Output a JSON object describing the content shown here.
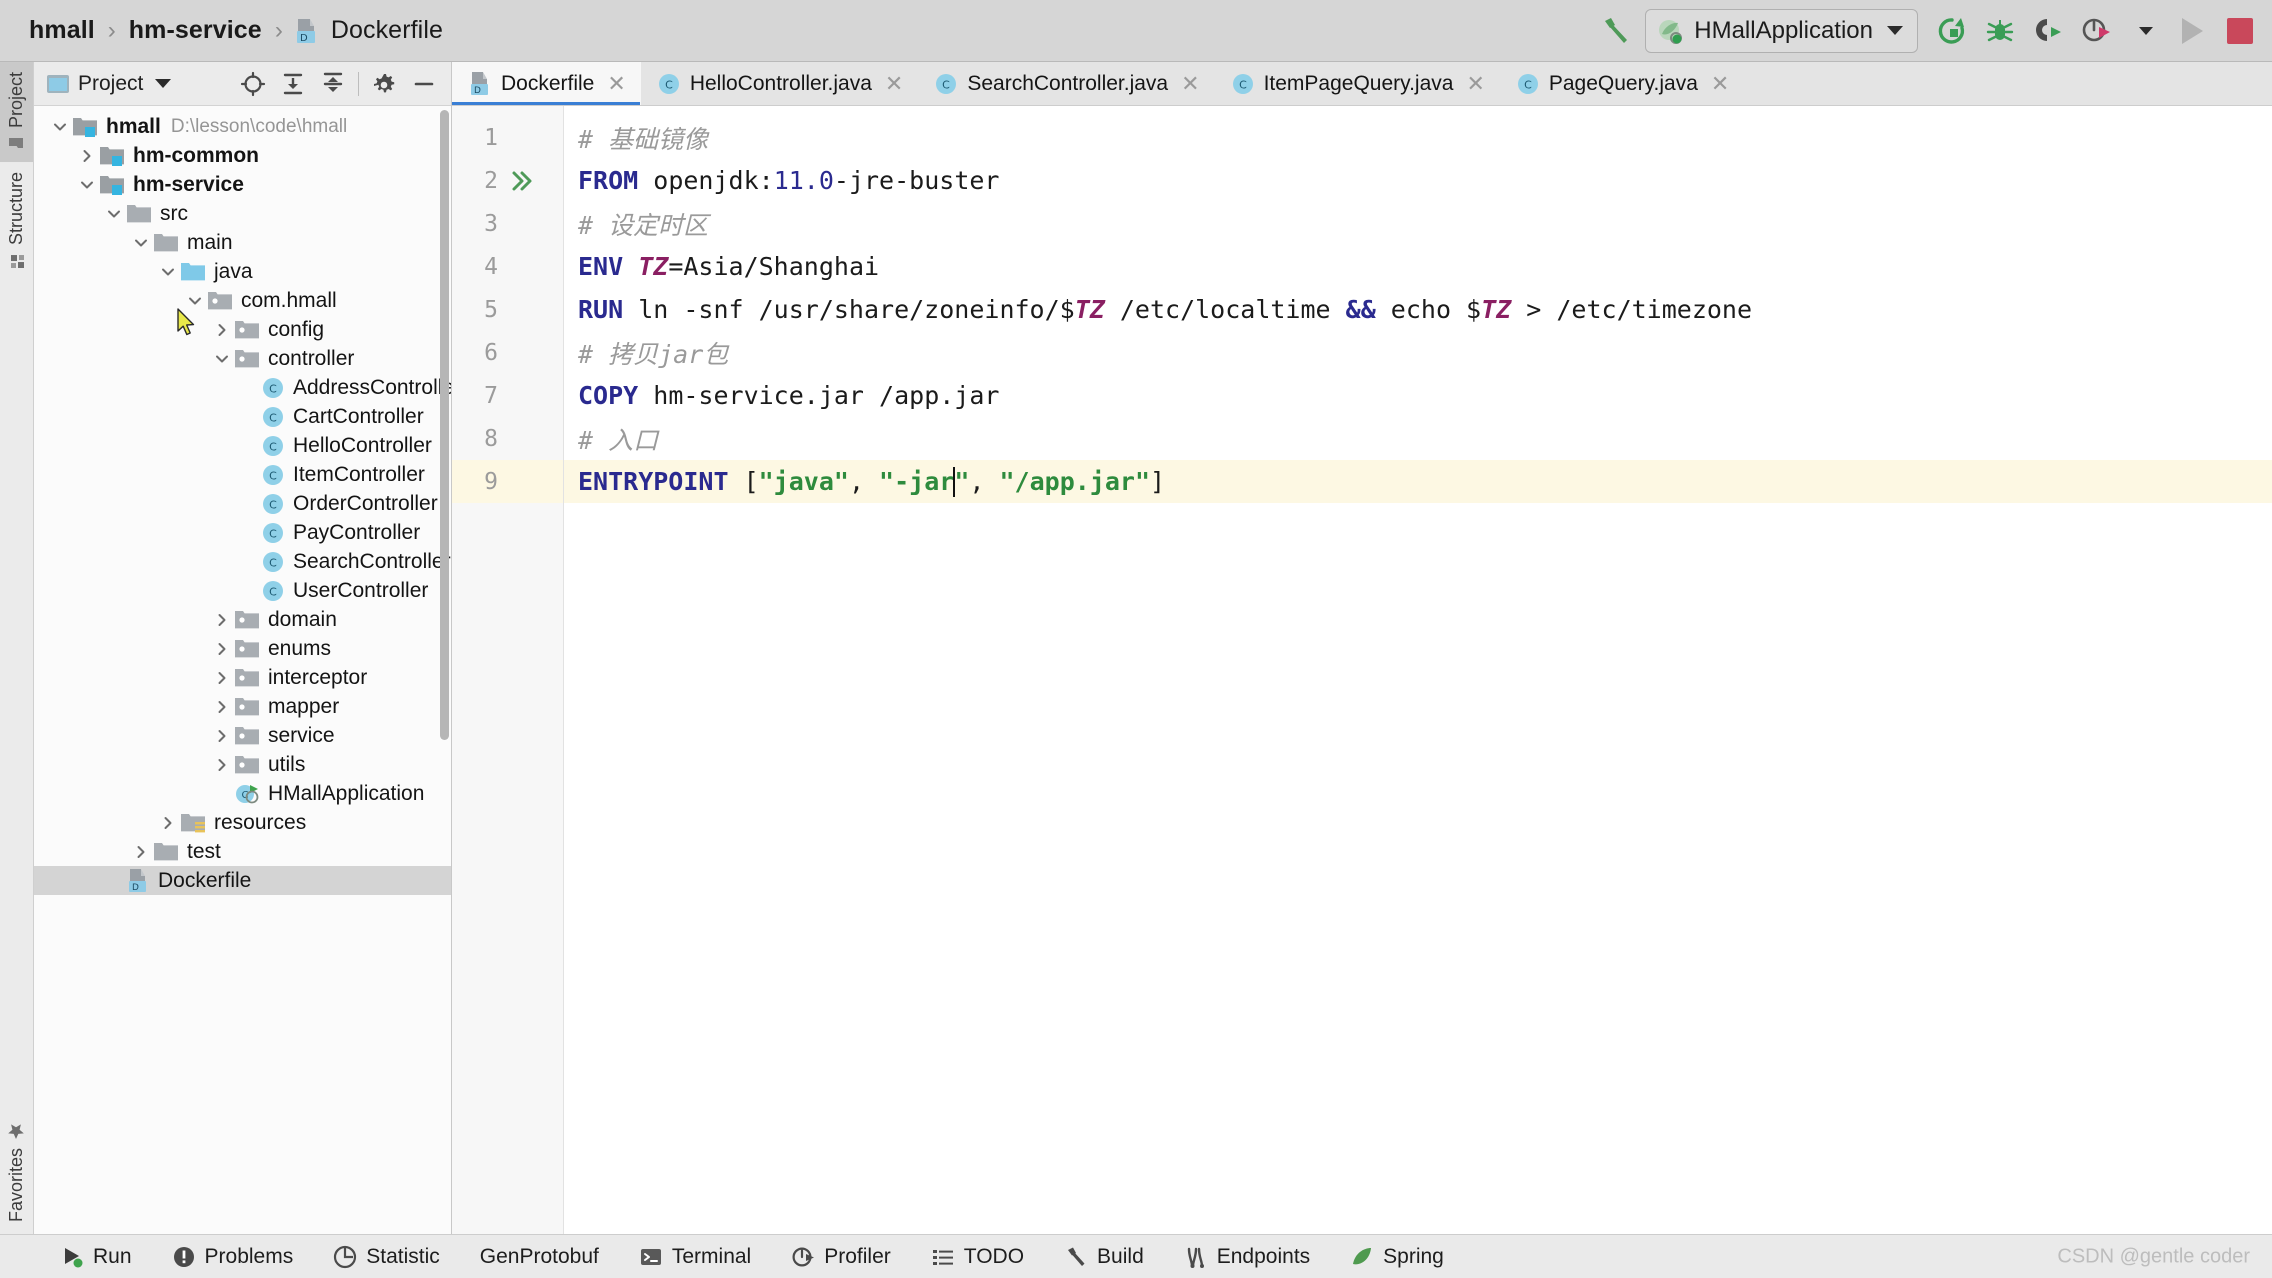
{
  "window": {
    "app": "IntelliJ IDEA",
    "watermark": "CSDN @gentle coder"
  },
  "breadcrumb": {
    "project": "hmall",
    "module": "hm-service",
    "file": "Dockerfile",
    "separator": "›"
  },
  "toolbar": {
    "build_icon": "hammer-icon",
    "run_config": {
      "label": "HMallApplication",
      "icon": "spring-boot-icon"
    },
    "buttons": [
      {
        "name": "rerun-icon",
        "title": "Rerun"
      },
      {
        "name": "debug-icon",
        "title": "Debug"
      },
      {
        "name": "run-with-coverage-icon",
        "title": "Run with Coverage"
      },
      {
        "name": "profiler-run-icon",
        "title": "Profile"
      },
      {
        "name": "chevron-down-icon",
        "title": "More"
      },
      {
        "name": "run-icon",
        "title": "Run"
      },
      {
        "name": "stop-icon",
        "title": "Stop"
      }
    ]
  },
  "rail": {
    "top": [
      {
        "label": "Project",
        "icon": "folder-icon",
        "active": true
      },
      {
        "label": "Structure",
        "icon": "structure-icon",
        "active": false
      }
    ],
    "bottom": [
      {
        "label": "Favorites",
        "icon": "star-icon",
        "active": false
      }
    ]
  },
  "project_panel": {
    "title": "Project",
    "title_caret": "▾",
    "actions": [
      {
        "name": "locate-file-icon"
      },
      {
        "name": "expand-all-icon"
      },
      {
        "name": "collapse-all-icon"
      },
      {
        "name": "settings-gear-icon"
      },
      {
        "name": "hide-panel-icon"
      }
    ],
    "tree": [
      {
        "indent": 0,
        "twisty": "down",
        "icon": "module-folder-icon",
        "label": "hmall",
        "bold": true,
        "path": "D:\\lesson\\code\\hmall",
        "selected": false
      },
      {
        "indent": 1,
        "twisty": "right",
        "icon": "module-folder-icon",
        "label": "hm-common",
        "bold": true,
        "path": "",
        "selected": false
      },
      {
        "indent": 1,
        "twisty": "down",
        "icon": "module-folder-icon",
        "label": "hm-service",
        "bold": true,
        "path": "",
        "selected": false
      },
      {
        "indent": 2,
        "twisty": "down",
        "icon": "folder-icon",
        "label": "src",
        "bold": false,
        "path": "",
        "selected": false
      },
      {
        "indent": 3,
        "twisty": "down",
        "icon": "folder-icon",
        "label": "main",
        "bold": false,
        "path": "",
        "selected": false
      },
      {
        "indent": 4,
        "twisty": "down",
        "icon": "source-folder-icon",
        "label": "java",
        "bold": false,
        "path": "",
        "selected": false
      },
      {
        "indent": 5,
        "twisty": "down",
        "icon": "package-icon",
        "label": "com.hmall",
        "bold": false,
        "path": "",
        "selected": false
      },
      {
        "indent": 6,
        "twisty": "right",
        "icon": "package-icon",
        "label": "config",
        "bold": false,
        "path": "",
        "selected": false
      },
      {
        "indent": 6,
        "twisty": "down",
        "icon": "package-icon",
        "label": "controller",
        "bold": false,
        "path": "",
        "selected": false
      },
      {
        "indent": 7,
        "twisty": "none",
        "icon": "java-class-icon",
        "label": "AddressController",
        "bold": false,
        "path": "",
        "selected": false
      },
      {
        "indent": 7,
        "twisty": "none",
        "icon": "java-class-icon",
        "label": "CartController",
        "bold": false,
        "path": "",
        "selected": false
      },
      {
        "indent": 7,
        "twisty": "none",
        "icon": "java-class-icon",
        "label": "HelloController",
        "bold": false,
        "path": "",
        "selected": false
      },
      {
        "indent": 7,
        "twisty": "none",
        "icon": "java-class-icon",
        "label": "ItemController",
        "bold": false,
        "path": "",
        "selected": false
      },
      {
        "indent": 7,
        "twisty": "none",
        "icon": "java-class-icon",
        "label": "OrderController",
        "bold": false,
        "path": "",
        "selected": false
      },
      {
        "indent": 7,
        "twisty": "none",
        "icon": "java-class-icon",
        "label": "PayController",
        "bold": false,
        "path": "",
        "selected": false
      },
      {
        "indent": 7,
        "twisty": "none",
        "icon": "java-class-icon",
        "label": "SearchController",
        "bold": false,
        "path": "",
        "selected": false
      },
      {
        "indent": 7,
        "twisty": "none",
        "icon": "java-class-icon",
        "label": "UserController",
        "bold": false,
        "path": "",
        "selected": false
      },
      {
        "indent": 6,
        "twisty": "right",
        "icon": "package-icon",
        "label": "domain",
        "bold": false,
        "path": "",
        "selected": false
      },
      {
        "indent": 6,
        "twisty": "right",
        "icon": "package-icon",
        "label": "enums",
        "bold": false,
        "path": "",
        "selected": false
      },
      {
        "indent": 6,
        "twisty": "right",
        "icon": "package-icon",
        "label": "interceptor",
        "bold": false,
        "path": "",
        "selected": false
      },
      {
        "indent": 6,
        "twisty": "right",
        "icon": "package-icon",
        "label": "mapper",
        "bold": false,
        "path": "",
        "selected": false
      },
      {
        "indent": 6,
        "twisty": "right",
        "icon": "package-icon",
        "label": "service",
        "bold": false,
        "path": "",
        "selected": false
      },
      {
        "indent": 6,
        "twisty": "right",
        "icon": "package-icon",
        "label": "utils",
        "bold": false,
        "path": "",
        "selected": false
      },
      {
        "indent": 6,
        "twisty": "none",
        "icon": "spring-boot-class-icon",
        "label": "HMallApplication",
        "bold": false,
        "path": "",
        "selected": false
      },
      {
        "indent": 4,
        "twisty": "right",
        "icon": "resources-folder-icon",
        "label": "resources",
        "bold": false,
        "path": "",
        "selected": false
      },
      {
        "indent": 3,
        "twisty": "right",
        "icon": "folder-icon",
        "label": "test",
        "bold": false,
        "path": "",
        "selected": false
      },
      {
        "indent": 2,
        "twisty": "none",
        "icon": "dockerfile-icon",
        "label": "Dockerfile",
        "bold": false,
        "path": "",
        "selected": true
      }
    ]
  },
  "editor": {
    "tabs": [
      {
        "label": "Dockerfile",
        "icon": "dockerfile-icon",
        "active": true,
        "close": "✕"
      },
      {
        "label": "HelloController.java",
        "icon": "java-class-icon",
        "active": false,
        "close": "✕"
      },
      {
        "label": "SearchController.java",
        "icon": "java-class-icon",
        "active": false,
        "close": "✕"
      },
      {
        "label": "ItemPageQuery.java",
        "icon": "java-class-icon",
        "active": false,
        "close": "✕"
      },
      {
        "label": "PageQuery.java",
        "icon": "java-class-icon",
        "active": false,
        "close": "✕"
      }
    ],
    "filename": "Dockerfile",
    "caret_line": 9,
    "lines": [
      {
        "num": "1",
        "gutter_icon": "",
        "highlight": false,
        "tokens": [
          {
            "t": "# 基础镜像",
            "c": "cmt"
          }
        ]
      },
      {
        "num": "2",
        "gutter_icon": "run-double-arrow-icon",
        "highlight": false,
        "tokens": [
          {
            "t": "FROM",
            "c": "kw"
          },
          {
            "t": " openjdk:",
            "c": "op"
          },
          {
            "t": "11.0",
            "c": "num"
          },
          {
            "t": "-jre-buster",
            "c": "op"
          }
        ]
      },
      {
        "num": "3",
        "gutter_icon": "",
        "highlight": false,
        "tokens": [
          {
            "t": "# 设定时区",
            "c": "cmt"
          }
        ]
      },
      {
        "num": "4",
        "gutter_icon": "",
        "highlight": false,
        "tokens": [
          {
            "t": "ENV",
            "c": "kw"
          },
          {
            "t": " ",
            "c": "op"
          },
          {
            "t": "TZ",
            "c": "var"
          },
          {
            "t": "=Asia/Shanghai",
            "c": "op"
          }
        ]
      },
      {
        "num": "5",
        "gutter_icon": "",
        "highlight": false,
        "tokens": [
          {
            "t": "RUN",
            "c": "kw"
          },
          {
            "t": " ln -snf /usr/share/zoneinfo/$",
            "c": "op"
          },
          {
            "t": "TZ",
            "c": "var"
          },
          {
            "t": " /etc/localtime ",
            "c": "op"
          },
          {
            "t": "&&",
            "c": "amp"
          },
          {
            "t": " echo $",
            "c": "op"
          },
          {
            "t": "TZ",
            "c": "var"
          },
          {
            "t": " > /etc/timezone",
            "c": "op"
          }
        ]
      },
      {
        "num": "6",
        "gutter_icon": "",
        "highlight": false,
        "tokens": [
          {
            "t": "# 拷贝jar包",
            "c": "cmt"
          }
        ]
      },
      {
        "num": "7",
        "gutter_icon": "",
        "highlight": false,
        "tokens": [
          {
            "t": "COPY",
            "c": "kw"
          },
          {
            "t": " hm-service.jar /app.jar",
            "c": "op"
          }
        ]
      },
      {
        "num": "8",
        "gutter_icon": "",
        "highlight": false,
        "tokens": [
          {
            "t": "# 入口",
            "c": "cmt"
          }
        ]
      },
      {
        "num": "9",
        "gutter_icon": "",
        "highlight": true,
        "tokens": [
          {
            "t": "ENTRYPOINT",
            "c": "kw"
          },
          {
            "t": " [",
            "c": "brk"
          },
          {
            "t": "\"java\"",
            "c": "str"
          },
          {
            "t": ", ",
            "c": "brk"
          },
          {
            "t": "\"-jar",
            "c": "str"
          },
          {
            "t": "|CARET|",
            "c": "caret"
          },
          {
            "t": "\"",
            "c": "str"
          },
          {
            "t": ", ",
            "c": "brk"
          },
          {
            "t": "\"/app.jar\"",
            "c": "str"
          },
          {
            "t": "]",
            "c": "brk"
          }
        ]
      }
    ]
  },
  "statusbar": {
    "items": [
      {
        "label": "Run",
        "icon": "run-green-icon"
      },
      {
        "label": "Problems",
        "icon": "problems-icon"
      },
      {
        "label": "Statistic",
        "icon": "statistic-icon"
      },
      {
        "label": "GenProtobuf",
        "icon": ""
      },
      {
        "label": "Terminal",
        "icon": "terminal-icon"
      },
      {
        "label": "Profiler",
        "icon": "profiler-icon"
      },
      {
        "label": "TODO",
        "icon": "todo-list-icon"
      },
      {
        "label": "Build",
        "icon": "hammer-icon"
      },
      {
        "label": "Endpoints",
        "icon": "endpoints-icon"
      },
      {
        "label": "Spring",
        "icon": "spring-leaf-icon"
      }
    ]
  },
  "colors": {
    "accent_blue": "#3a7fd5",
    "keyword": "#2a2a8f",
    "string": "#2e8b3d",
    "comment": "#9a9a9a",
    "variable": "#8a1f62",
    "caret_line_bg": "#fdf8e3",
    "stop_red": "#c9485b",
    "run_green": "#4e9a58"
  }
}
